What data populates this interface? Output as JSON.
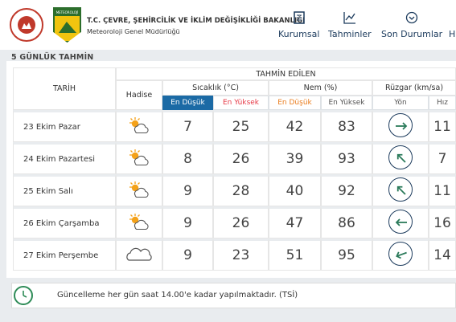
{
  "header": {
    "ministry": "T.C. ÇEVRE, ŞEHİRCİLİK VE İKLİM DEĞİŞİKLİĞİ BAKANLIĞI",
    "subtitle": "Meteoroloji Genel Müdürlüğü",
    "logo2_text": "METEOROLOJİ",
    "nav": [
      {
        "label": "Kurumsal",
        "icon": "document-icon"
      },
      {
        "label": "Tahminler",
        "icon": "chart-icon"
      },
      {
        "label": "Son Durumlar",
        "icon": "chevron-circle-icon"
      },
      {
        "label": "H",
        "icon": "more-icon"
      }
    ]
  },
  "section_title": "5 GÜNLÜK TAHMİN",
  "table": {
    "group_header": "TAHMİN EDİLEN",
    "date_header": "TARİH",
    "event_header": "Hadise",
    "temp_header": "Sıcaklık (°C)",
    "hum_header": "Nem (%)",
    "wind_header": "Rüzgar (km/sa)",
    "low_label": "En Düşük",
    "high_label": "En Yüksek",
    "dir_label": "Yön",
    "speed_label": "Hız",
    "rows": [
      {
        "date": "23 Ekim Pazar",
        "weather": "partly-cloudy",
        "tmin": "7",
        "tmax": "25",
        "hmin": "42",
        "hmax": "83",
        "dir": "east",
        "speed": "11"
      },
      {
        "date": "24 Ekim Pazartesi",
        "weather": "partly-cloudy",
        "tmin": "8",
        "tmax": "26",
        "hmin": "39",
        "hmax": "93",
        "dir": "northwest",
        "speed": "7"
      },
      {
        "date": "25 Ekim Salı",
        "weather": "partly-cloudy",
        "tmin": "9",
        "tmax": "28",
        "hmin": "40",
        "hmax": "92",
        "dir": "northwest",
        "speed": "11"
      },
      {
        "date": "26 Ekim Çarşamba",
        "weather": "partly-cloudy",
        "tmin": "9",
        "tmax": "26",
        "hmin": "47",
        "hmax": "86",
        "dir": "west",
        "speed": "16"
      },
      {
        "date": "27 Ekim Perşembe",
        "weather": "cloudy",
        "tmin": "9",
        "tmax": "23",
        "hmin": "51",
        "hmax": "95",
        "dir": "west-southwest",
        "speed": "14"
      }
    ]
  },
  "update_note": "Güncelleme her gün saat 14.00'e kadar yapılmaktadır. (TSİ)",
  "colors": {
    "blue": "#1b6aa5",
    "red": "#e63946",
    "orange": "#ea7c1c",
    "navy": "#1b3a5c"
  }
}
